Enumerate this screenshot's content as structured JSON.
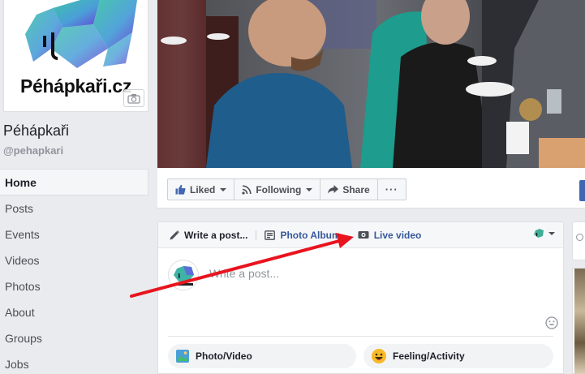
{
  "page": {
    "logo_text": "Péhápkaři.cz",
    "name": "Péhápkaři",
    "handle": "@pehapkari"
  },
  "nav": {
    "items": [
      {
        "label": "Home",
        "active": true
      },
      {
        "label": "Posts"
      },
      {
        "label": "Events"
      },
      {
        "label": "Videos"
      },
      {
        "label": "Photos"
      },
      {
        "label": "About"
      },
      {
        "label": "Groups"
      },
      {
        "label": "Jobs"
      }
    ]
  },
  "actions": {
    "liked": "Liked",
    "following": "Following",
    "share": "Share",
    "more": "···"
  },
  "composer": {
    "write_tab": "Write a post...",
    "photo_album_tab": "Photo Album",
    "live_video_tab": "Live video",
    "placeholder": "Write a post...",
    "photo_video": "Photo/Video",
    "feeling": "Feeling/Activity"
  },
  "colors": {
    "brand_blue": "#4267b2",
    "link_blue": "#365899",
    "annotation_red": "#e8141e"
  },
  "icons": {
    "pencil": "pencil-icon",
    "album": "photo-album-icon",
    "live": "video-camera-icon",
    "thumb": "thumbs-up-icon",
    "rss": "following-icon",
    "share": "share-arrow-icon",
    "emoji": "smiley-icon"
  }
}
